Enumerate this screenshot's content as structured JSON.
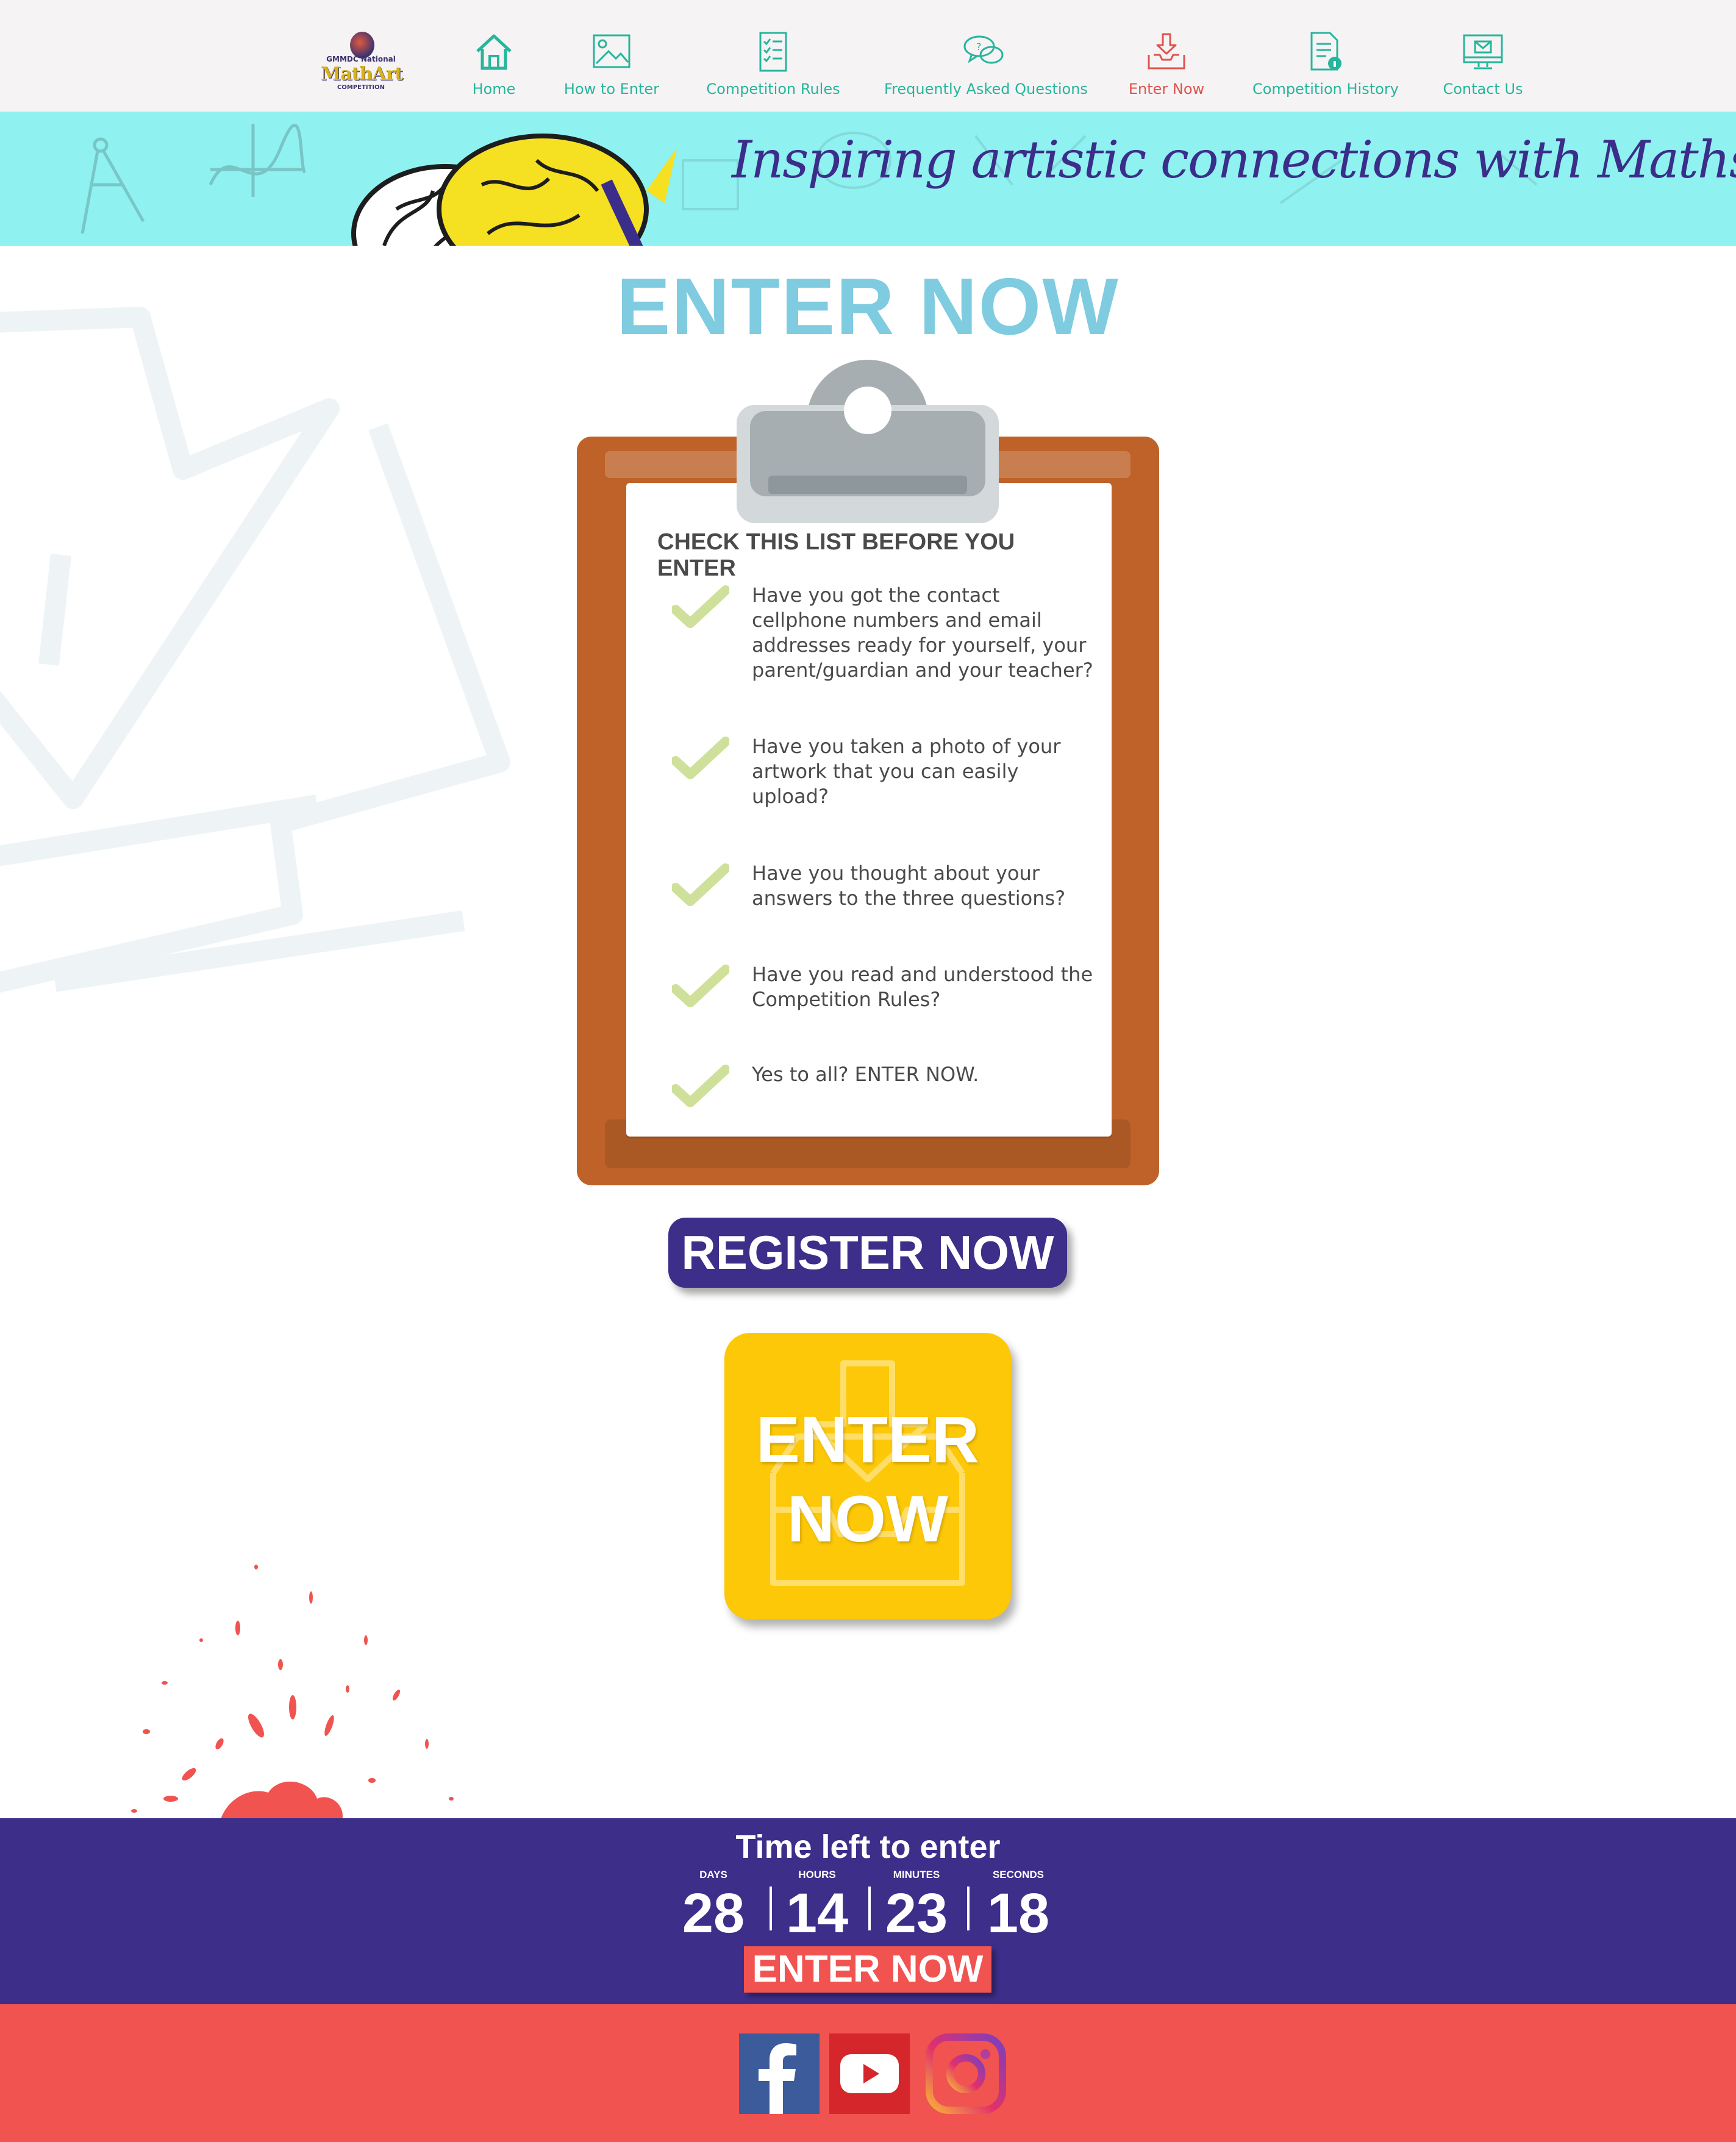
{
  "nav": {
    "logo": {
      "line1": "GMMDC National",
      "line2": "MathArt",
      "line3": "COMPETITION"
    },
    "items": [
      {
        "label": "Home",
        "icon": "home-icon"
      },
      {
        "label": "How to Enter",
        "icon": "picture-icon"
      },
      {
        "label": "Competition Rules",
        "icon": "checklist-icon"
      },
      {
        "label": "Frequently Asked Questions",
        "icon": "speech-bubbles-icon"
      },
      {
        "label": "Enter Now",
        "icon": "download-tray-icon",
        "active": true
      },
      {
        "label": "Competition History",
        "icon": "document-info-icon"
      },
      {
        "label": "Contact Us",
        "icon": "monitor-mail-icon"
      }
    ],
    "color": "#27b59c",
    "active_color": "#e0534d"
  },
  "banner": {
    "tagline": "Inspiring artistic connections with Maths",
    "background": "#8ff1f0"
  },
  "main": {
    "title": "ENTER NOW",
    "checklist": {
      "heading": "CHECK THIS LIST BEFORE YOU ENTER",
      "items": [
        "Have you got the contact cellphone numbers and email addresses ready for yourself, your parent/guardian and your teacher?",
        "Have you taken a photo of your artwork that you can easily upload?",
        "Have you thought about your answers to the three questions?",
        "Have you read and understood the Competition Rules?",
        "Yes to all? ENTER NOW."
      ]
    },
    "register_label": "REGISTER NOW",
    "enter_tile_line1": "ENTER",
    "enter_tile_line2": "NOW"
  },
  "countdown": {
    "title": "Time left to enter",
    "units": [
      {
        "label": "DAYS",
        "value": "28"
      },
      {
        "label": "HOURS",
        "value": "14"
      },
      {
        "label": "MINUTES",
        "value": "23"
      },
      {
        "label": "SECONDS",
        "value": "18"
      }
    ],
    "button_label": "ENTER NOW"
  },
  "footer": {
    "social": [
      "facebook-icon",
      "youtube-icon",
      "instagram-icon"
    ]
  },
  "colors": {
    "accent_purple": "#3d2e8a",
    "accent_red": "#f05350",
    "title_blue": "#7fcbe0",
    "tile_yellow": "#fdc808",
    "clipboard_brown": "#be6229",
    "tick_green": "#cfe09a"
  }
}
